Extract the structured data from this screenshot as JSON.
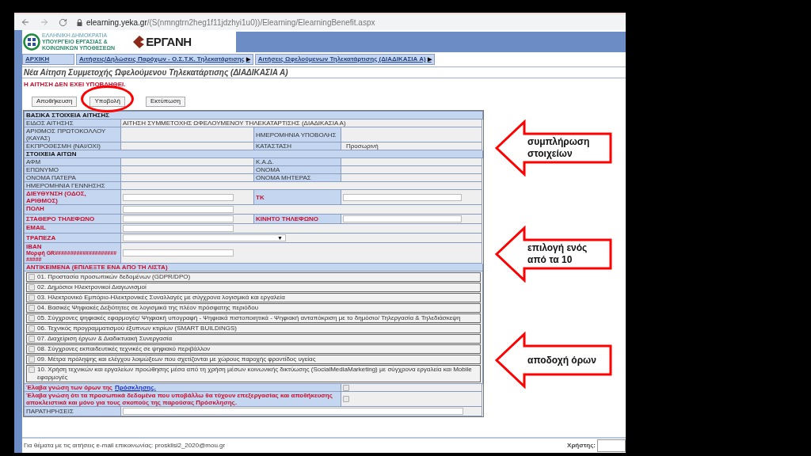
{
  "browser": {
    "url_host": "elearning.yeka.gr",
    "url_path": "/(S(nmngtrn2heg1f11jdzhyi1u0))/Elearning/ElearningBenefit.aspx"
  },
  "header": {
    "ministry_lines": [
      "ΕΛΛΗΝΙΚΗ ΔΗΜΟΚΡΑΤΙΑ",
      "ΥΠΟΥΡΓΕΙΟ ΕΡΓΑΣΙΑΣ &",
      "ΚΟΙΝΩΝΙΚΩΝ ΥΠΟΘΕΣΕΩΝ"
    ],
    "logo_text": "ΕΡΓΑΝΗ"
  },
  "nav": [
    {
      "label": "ΑΡΧΙΚΗ"
    },
    {
      "label": "Αιτήσεις/Δηλώσεις Παρόχων - Ο.Σ.Τ.Κ. Τηλεκατάρτισης",
      "arrow": "▶"
    },
    {
      "label": "Αιτήσεις Ωφελούμενων Τηλεκατάρτισης (ΔΙΑΔΙΚΑΣΙΑ Α)",
      "arrow": "▶"
    }
  ],
  "page_title": "Νέα Αίτηση Συμμετοχής Ωφελούμενου Τηλεκατάρτισης (ΔΙΑΔΙΚΑΣΙΑ Α)",
  "status_message": "Η ΑΙΤΗΣΗ ΔΕΝ ΕΧΕΙ ΥΠΟΒΛΗΘΕΙ.",
  "buttons": [
    {
      "label": "Αποθήκευση",
      "circled": false
    },
    {
      "label": "Υποβολή",
      "circled": true
    },
    {
      "label": "Εκτύπωση",
      "circled": false
    }
  ],
  "form_rows": [
    {
      "kind": "section",
      "label": "ΒΑΣΙΚΑ ΣΤΟΙΧΕΙΑ ΑΙΤΗΣΗΣ",
      "required": false
    },
    {
      "kind": "wide",
      "label": "ΕΙΔΟΣ ΑΙΤΗΣΗΣ",
      "value": "ΑΙΤΗΣΗ ΣΥΜΜΕΤΟΧΗΣ ΩΦΕΛΟΥΜΕΝΟΥ ΤΗΛΕΚΑΤΑΡΤΙΣΗΣ (ΔΙΑΔΙΚΑΣΙΑ Α)"
    },
    {
      "kind": "pair",
      "label": "ΑΡΙΘΜΟΣ ΠΡΩΤΟΚΟΛΛΟΥ (ΚΑΥΑΣ)",
      "label2": "ΗΜΕΡΟΜΗΝΙΑ ΥΠΟΒΟΛΗΣ"
    },
    {
      "kind": "pair",
      "label": "ΕΚΠΡΟΘΕΣΜΗ (ΝΑΙ/ΟΧΙ)",
      "label2": "ΚΑΤΑΣΤΑΣΗ",
      "value2": "Προσωρινή"
    },
    {
      "kind": "section",
      "label": "ΣΤΟΙΧΕΙΑ ΑΙΤΩΝ",
      "required": false
    },
    {
      "kind": "pair",
      "label": "ΑΦΜ",
      "label2": "Κ.Α.Δ."
    },
    {
      "kind": "pair",
      "label": "ΕΠΩΝΥΜΟ",
      "label2": "ΟΝΟΜΑ"
    },
    {
      "kind": "pair",
      "label": "ΟΝΟΜΑ ΠΑΤΕΡΑ",
      "label2": "ΟΝΟΜΑ ΜΗΤΕΡΑΣ"
    },
    {
      "kind": "single",
      "label": "ΗΜΕΡΟΜΗΝΙΑ ΓΕΝΝΗΣΗΣ"
    },
    {
      "kind": "input_pair",
      "label": "ΔΙΕΥΘΥΝΣΗ (ΟΔΟΣ, ΑΡΙΘΜΟΣ)",
      "label2": "ΤΚ"
    },
    {
      "kind": "input",
      "label": "ΠΟΛΗ"
    },
    {
      "kind": "input_pair",
      "label": "ΣΤΑΘΕΡΟ ΤΗΛΕΦΩΝΟ",
      "label2": "ΚΙΝΗΤΟ ΤΗΛΕΦΩΝΟ"
    },
    {
      "kind": "input",
      "label": "EMAIL"
    },
    {
      "kind": "select",
      "label": "ΤΡΑΠΕΖΑ",
      "arrow": "▼"
    },
    {
      "kind": "input",
      "label": "IBAN",
      "hint": "Μορφή GR#########################"
    },
    {
      "kind": "section",
      "label": "ΑΝΤΙΚΕΙΜΕΝΑ (ΕΠΙΛΕΞΤΕ ΕΝΑ ΑΠΟ ΤΗ ΛΙΣΤΑ)",
      "required": true
    }
  ],
  "subjects": [
    {
      "label": "01. Προστασία προσωπικών δεδομένων (GDPR/DPO)",
      "checked": false
    },
    {
      "label": "02. Δημόσιοι Ηλεκτρονικοί Διαγωνισμοί",
      "checked": false
    },
    {
      "label": "03. Ηλεκτρονικό Εμπόριο-Ηλεκτρονικές Συναλλαγές με σύγχρονα λογισμικά και εργαλεία",
      "checked": false
    },
    {
      "label": "04. Βασικές Ψηφιακές Δεξιότητες σε λογισμικά της πλέον πρόσφατης περιόδου",
      "checked": false
    },
    {
      "label": "05. Σύγχρονες ψηφιακές εφαρμογές/ Ψηφιακή υπογραφή - Ψηφιακά πιστοποιητικά - Ψηφιακή ανταπόκριση με το δημόσιο/ Τηλεργασία & Τηλεδιάσκεψη",
      "checked": false
    },
    {
      "label": "06. Τεχνικός προγραμματισμού έξυπνων κτιρίων (SMART BUILDINGS)",
      "checked": false
    },
    {
      "label": "07. Διαχείριση έργων & Διαδικτυακή Συνεργασία",
      "checked": false
    },
    {
      "label": "08. Σύγχρονες εκπαιδευτικές τεχνικές σε ψηφιακό περιβάλλον",
      "checked": false
    },
    {
      "label": "09. Μέτρα πρόληψης και ελέγχου λοιμώξεων που σχετίζονται με χώρους παροχής φροντίδος υγείας",
      "checked": false
    },
    {
      "label": "10. Χρήση τεχνικών και εργαλείων προώθησης μέσα από τη χρήση μέσων κοινωνικής δικτύωσης (SocialMediaMarketing) με σύγχρονα εργαλεία και Mobile εφαρμογές",
      "checked": false
    }
  ],
  "terms": [
    {
      "text": "Έλαβα γνώση των όρων της",
      "link": "Πρόσκλησης.",
      "checked": false
    },
    {
      "text": "Έλαβα γνώση ότι τα προσωπικά δεδομένα που υποβάλλω θα τύχουν επεξεργασίας και αποθήκευσης αποκλειστικά και μόνο για τους σκοπούς της παρούσας Πρόσκλησης.",
      "checked": false
    }
  ],
  "remarks_label": "ΠΑΡΑΤΗΡΗΣΕΙΣ",
  "footer": {
    "text": "Για θέματα με τις αιτήσεις e-mail επικοινωνίας: prosklisi2_2020@mou.gr",
    "user_label": "Χρήστης:"
  },
  "annotations": [
    {
      "lines": [
        "συμπλήρωση",
        "στοιχείων"
      ]
    },
    {
      "lines": [
        "επιλογή ενός",
        "από τα 10"
      ]
    },
    {
      "lines": [
        "αποδοχή όρων"
      ]
    }
  ]
}
